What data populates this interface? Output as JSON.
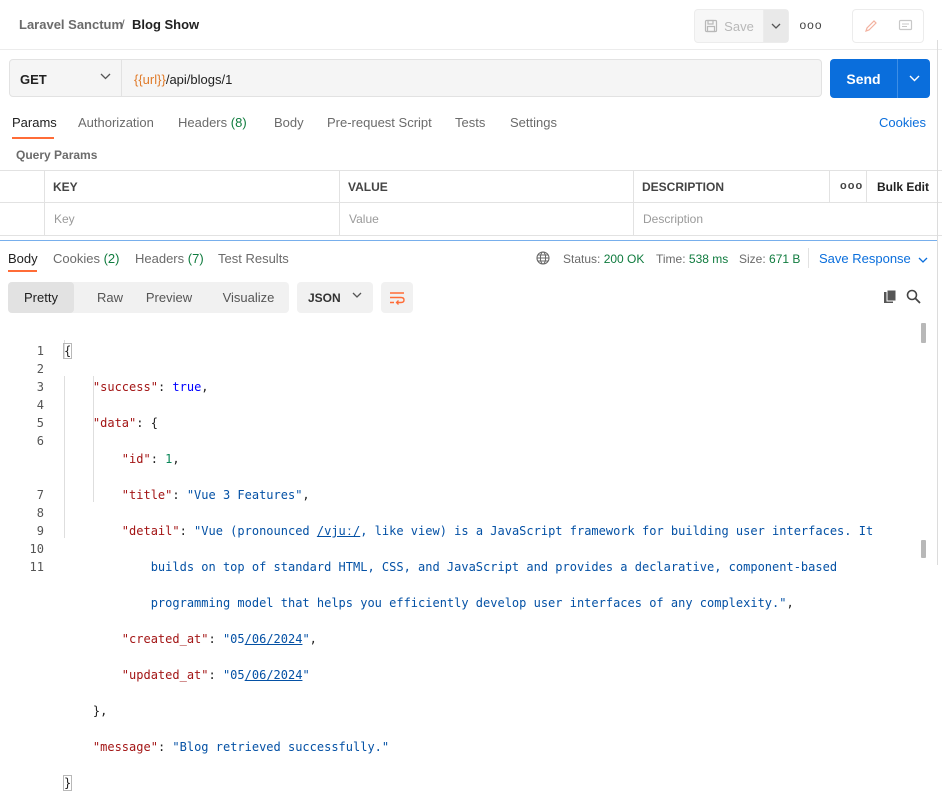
{
  "header": {
    "collection": "Laravel Sanctum",
    "separator": "/",
    "request_name": "Blog Show",
    "save_label": "Save",
    "more_label": "ooo"
  },
  "request": {
    "method": "GET",
    "url_variable": "{{url}}",
    "url_path": "/api/blogs/1",
    "send_label": "Send"
  },
  "request_tabs": [
    {
      "label": "Params",
      "count": ""
    },
    {
      "label": "Authorization",
      "count": ""
    },
    {
      "label": "Headers",
      "count": "(8)"
    },
    {
      "label": "Body",
      "count": ""
    },
    {
      "label": "Pre-request Script",
      "count": ""
    },
    {
      "label": "Tests",
      "count": ""
    },
    {
      "label": "Settings",
      "count": ""
    }
  ],
  "cookies_link": "Cookies",
  "query_params": {
    "title": "Query Params",
    "columns": [
      "KEY",
      "VALUE",
      "DESCRIPTION"
    ],
    "more_label": "ooo",
    "bulk_edit": "Bulk Edit",
    "placeholders": [
      "Key",
      "Value",
      "Description"
    ]
  },
  "response_tabs": [
    {
      "label": "Body",
      "count": ""
    },
    {
      "label": "Cookies",
      "count": "(2)"
    },
    {
      "label": "Headers",
      "count": "(7)"
    },
    {
      "label": "Test Results",
      "count": ""
    }
  ],
  "response_meta": {
    "status_label": "Status:",
    "status_value": "200 OK",
    "time_label": "Time:",
    "time_value": "538 ms",
    "size_label": "Size:",
    "size_value": "671 B",
    "save_response": "Save Response"
  },
  "view_modes": [
    "Pretty",
    "Raw",
    "Preview",
    "Visualize"
  ],
  "format": "JSON",
  "code": {
    "line_numbers": [
      "1",
      "2",
      "3",
      "4",
      "5",
      "6",
      "7",
      "8",
      "9",
      "10",
      "11"
    ],
    "success_key": "\"success\"",
    "success_val": "true",
    "data_key": "\"data\"",
    "id_key": "\"id\"",
    "id_val": "1",
    "title_key": "\"title\"",
    "title_val": "\"Vue 3 Features\"",
    "detail_key": "\"detail\"",
    "detail_val_1a": "\"Vue (pronounced ",
    "detail_val_1b": "/vjuː/",
    "detail_val_1c": ", like view) is a JavaScript framework for building user interfaces. It",
    "detail_val_2": "builds on top of standard HTML, CSS, and JavaScript and provides a declarative, component-based",
    "detail_val_3": "programming model that helps you efficiently develop user interfaces of any complexity.\"",
    "created_key": "\"created_at\"",
    "created_val_a": "\"05",
    "created_val_b": "/06/2024",
    "created_val_c": "\"",
    "updated_key": "\"updated_at\"",
    "updated_val_a": "\"05",
    "updated_val_b": "/06/2024",
    "updated_val_c": "\"",
    "message_key": "\"message\"",
    "message_val": "\"Blog retrieved successfully.\""
  },
  "colors": {
    "accent": "#ff6c37",
    "primary": "#0a6edc",
    "status_ok": "#0f7b3e",
    "variable": "#e07b2a"
  }
}
